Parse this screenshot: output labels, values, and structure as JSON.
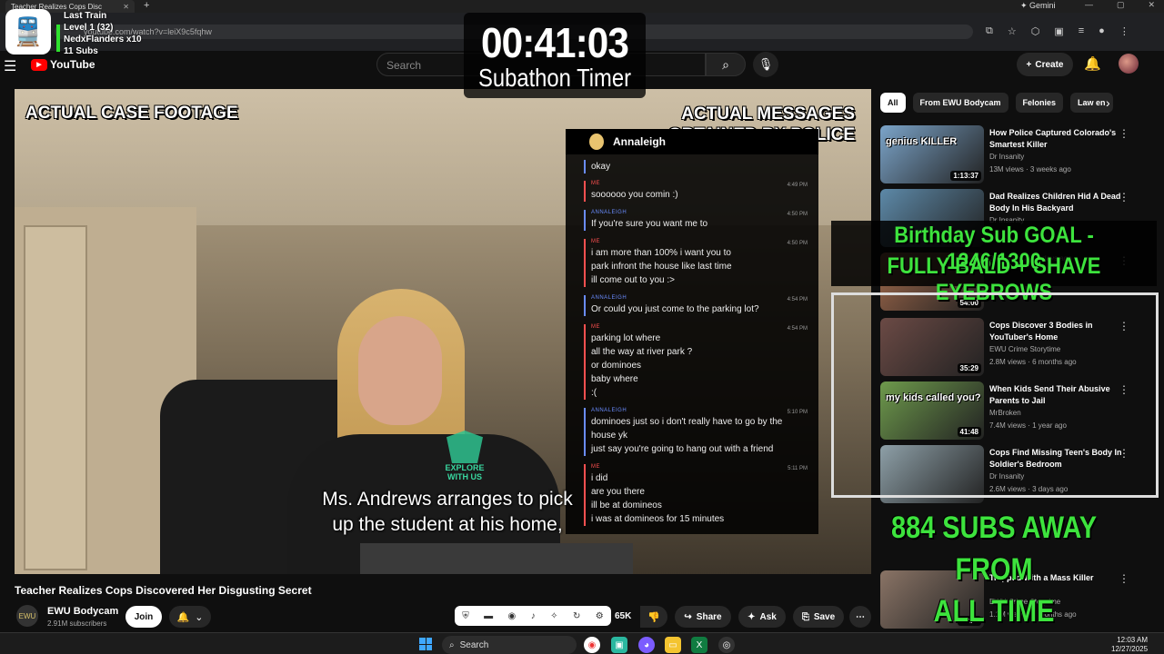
{
  "browser": {
    "tab_title": "Teacher Realizes Cops Disc",
    "url": "youtube.com/watch?v=leiX9c5fqhw",
    "gemini_label": "Gemini"
  },
  "stream": {
    "line1": "Last Train",
    "line2": "Level 1  (32)",
    "line3": "NedxFlanders x10",
    "line4": "11 Subs",
    "timer": "00:41:03",
    "timer_label": "Subathon Timer",
    "goal_line1": "Birthday Sub GOAL - 1246/1300",
    "goal_line2": "FULLY BALD + SHAVE EYEBROWS",
    "subs_away_line1": "884 SUBS AWAY FROM",
    "subs_away_line2": "ALL TIME !SUBRECORD"
  },
  "header": {
    "logo_text": "YouTube",
    "search_placeholder": "Search",
    "create_label": "Create"
  },
  "video": {
    "caption_left": "ACTUAL CASE FOOTAGE",
    "caption_right": "ACTUAL MESSAGES OBTAINED BY POLICE",
    "subtitle_line1": "Ms. Andrews arranges to pick",
    "subtitle_line2": "up the student at his home,",
    "watermark_text": "EXPLORE WITH US",
    "chat_name": "Annaleigh",
    "messages": [
      {
        "sender": "",
        "lines": [
          "okay"
        ],
        "time": ""
      },
      {
        "sender": "ME",
        "lines": [
          "soooooo you comin :)"
        ],
        "time": "4:49 PM"
      },
      {
        "sender": "ANNALEIGH",
        "lines": [
          "If you're sure you want me to"
        ],
        "time": "4:50 PM"
      },
      {
        "sender": "ME",
        "lines": [
          "i am more than 100% i want you to",
          "park infront the house like last time",
          "ill come out to you  :>"
        ],
        "time": "4:50 PM"
      },
      {
        "sender": "ANNALEIGH",
        "lines": [
          "Or could you just come to the parking lot?"
        ],
        "time": "4:54 PM"
      },
      {
        "sender": "ME",
        "lines": [
          "parking lot where",
          "all the way at river park ?",
          "or dominoes",
          "baby where",
          ":("
        ],
        "time": "4:54 PM"
      },
      {
        "sender": "ANNALEIGH",
        "lines": [
          "dominoes just so i don't really have to go by the",
          "house yk",
          "just say you're going to hang out with a friend"
        ],
        "time": "5:10 PM"
      },
      {
        "sender": "ME",
        "lines": [
          "i did",
          "are you there",
          "ill be at domineos",
          "i was at domineos for 15 minutes"
        ],
        "time": "5:11 PM"
      }
    ]
  },
  "info": {
    "title": "Teacher Realizes Cops Discovered Her Disgusting Secret",
    "channel": "EWU Bodycam",
    "subscribers": "2.91M subscribers",
    "join_label": "Join",
    "likes": "65K",
    "share_label": "Share",
    "ask_label": "Ask",
    "save_label": "Save"
  },
  "chips": [
    "All",
    "From EWU Bodycam",
    "Felonies",
    "Law en"
  ],
  "recommendations": [
    {
      "title": "How Police Captured Colorado's Smartest Killer",
      "channel": "Dr Insanity",
      "meta": "13M views · 3 weeks ago",
      "duration": "1:13:37",
      "thumb_text": "genius KILLER",
      "color": "#7ba4c9"
    },
    {
      "title": "Dad Realizes Children Hid A Dead Body In His Backyard",
      "channel": "Dr Insanity",
      "meta": "",
      "duration": "",
      "thumb_text": "",
      "color": "#5d89a8"
    },
    {
      "title": "",
      "channel": "Dr Insanity",
      "meta": "3.7M views · 13 days ago",
      "duration": "54:00",
      "thumb_text": "",
      "color": "#a36a4c"
    },
    {
      "title": "Cops Discover 3 Bodies in YouTuber's Home",
      "channel": "EWU Crime Storytime",
      "meta": "2.8M views · 6 months ago",
      "duration": "35:29",
      "thumb_text": "",
      "color": "#6b4a45"
    },
    {
      "title": "When Kids Send Their Abusive Parents to Jail",
      "channel": "MrBroken",
      "meta": "7.4M views · 1 year ago",
      "duration": "41:48",
      "thumb_text": "my kids called you?",
      "color": "#6e9a4c"
    },
    {
      "title": "Cops Find Missing Teen's Body In Soldier's Bedroom",
      "channel": "Dr Insanity",
      "meta": "2.6M views · 3 days ago",
      "duration": "",
      "thumb_text": "",
      "color": "#8ea0a8"
    },
    {
      "title": "Trapped With a Mass Killer",
      "channel": "EWU Crime Storytime",
      "meta": "1.1M views · 7 months ago",
      "duration": "25:15",
      "thumb_text": "",
      "color": "#8a7466"
    }
  ],
  "taskbar": {
    "search_label": "Search",
    "time": "12:03 AM",
    "date": "12/27/2025"
  }
}
